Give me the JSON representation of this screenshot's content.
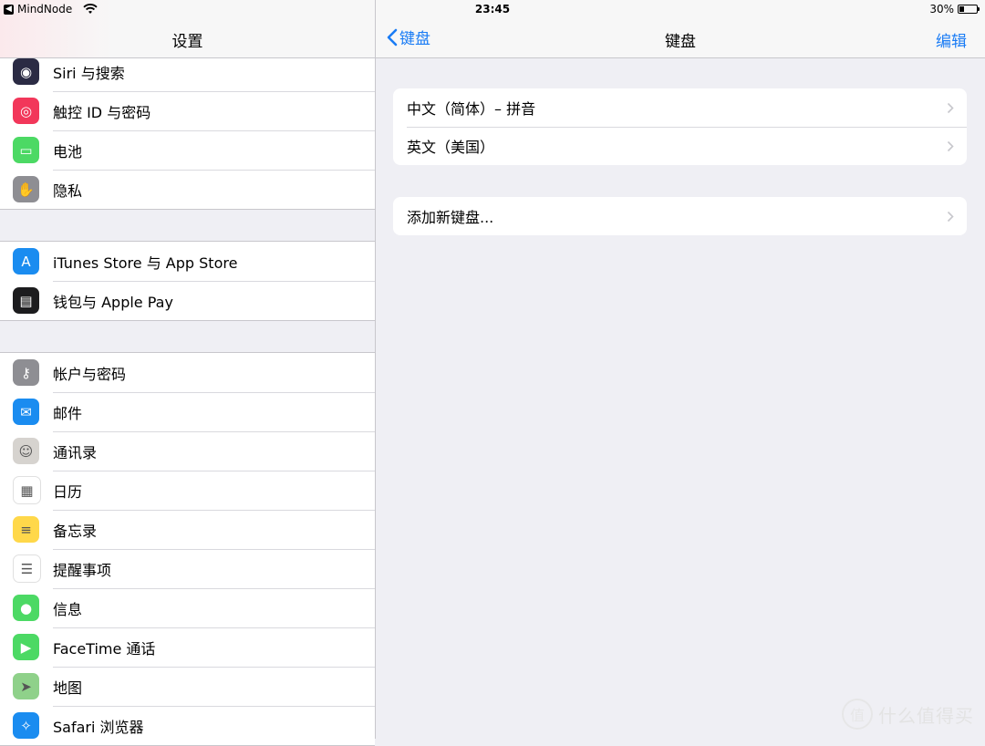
{
  "status_bar": {
    "app_back": "MindNode",
    "time": "23:45",
    "battery": "30%",
    "battery_level": 0.3
  },
  "sidebar": {
    "title": "设置",
    "groups": [
      {
        "items": [
          {
            "label": "Siri 与搜索",
            "icon": "siri-icon",
            "color": "#2b2b44"
          },
          {
            "label": "触控 ID 与密码",
            "icon": "fingerprint-icon",
            "color": "#f2375a"
          },
          {
            "label": "电池",
            "icon": "battery-icon",
            "color": "#4cd964"
          },
          {
            "label": "隐私",
            "icon": "hand-icon",
            "color": "#8e8e93"
          }
        ]
      },
      {
        "items": [
          {
            "label": "iTunes Store 与 App Store",
            "icon": "app-store-icon",
            "color": "#1a8cf0"
          },
          {
            "label": "钱包与 Apple Pay",
            "icon": "wallet-icon",
            "color": "#1c1c1e"
          }
        ]
      },
      {
        "items": [
          {
            "label": "帐户与密码",
            "icon": "key-icon",
            "color": "#8e8e93"
          },
          {
            "label": "邮件",
            "icon": "mail-icon",
            "color": "#1a8cf0"
          },
          {
            "label": "通讯录",
            "icon": "contacts-icon",
            "color": "#d6d3cf"
          },
          {
            "label": "日历",
            "icon": "calendar-icon",
            "color": "#ffffff"
          },
          {
            "label": "备忘录",
            "icon": "notes-icon",
            "color": "#ffd84a"
          },
          {
            "label": "提醒事项",
            "icon": "reminders-icon",
            "color": "#ffffff"
          },
          {
            "label": "信息",
            "icon": "messages-icon",
            "color": "#4cd964"
          },
          {
            "label": "FaceTime 通话",
            "icon": "facetime-icon",
            "color": "#4cd964"
          },
          {
            "label": "地图",
            "icon": "maps-icon",
            "color": "#8fd18a"
          },
          {
            "label": "Safari 浏览器",
            "icon": "safari-icon",
            "color": "#1a8cf0"
          }
        ]
      }
    ]
  },
  "detail": {
    "back_label": "键盘",
    "title": "键盘",
    "edit_label": "编辑",
    "keyboards": [
      "中文（简体）– 拼音",
      "英文（美国）"
    ],
    "add_label": "添加新键盘..."
  },
  "watermark": {
    "text": "什么值得买",
    "glyph": "值"
  }
}
